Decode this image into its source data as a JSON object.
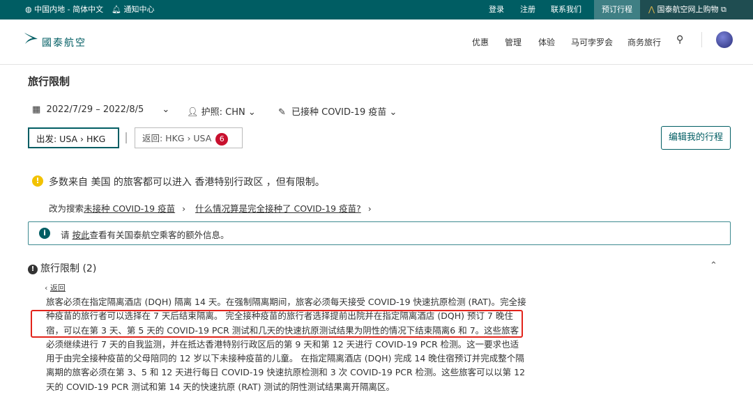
{
  "topbar": {
    "region": "中国内地 - 简体中文",
    "notifications": "通知中心",
    "login": "登录",
    "register": "注册",
    "contact": "联系我们",
    "book_trip": "预订行程",
    "shop": "国泰航空网上购物"
  },
  "nav": {
    "logo_text": "國泰航空",
    "items": [
      "优惠",
      "管理",
      "体验",
      "马可孛罗会",
      "商务旅行"
    ]
  },
  "page": {
    "title": "旅行限制",
    "filters": {
      "dates": "2022/7/29  –  2022/8/5",
      "passport": "护照: CHN",
      "vaccination": "已接种 COVID-19 疫苗"
    },
    "chips": {
      "outbound": "出发: USA  ›  HKG",
      "return": "返回: HKG  ›  USA",
      "return_count": "6"
    },
    "edit_button": "编辑我的行程",
    "summary": "多数来自 美国 的旅客都可以进入 香港特别行政区 ，但有限制。",
    "links": {
      "prefix": "改为搜索",
      "unvaccinated": "未接种 COVID-19 疫苗",
      "fully_vaccinated": "什么情况算是完全接种了 COVID-19 疫苗?"
    },
    "info": {
      "prefix": "请 ",
      "link": "按此",
      "suffix": "查看有关国泰航空乘客的额外信息。"
    },
    "section": {
      "title": "旅行限制 (2)",
      "back": "返回",
      "paragraph": "旅客必须在指定隔离酒店 (DQH) 隔离 14 天。在强制隔离期间，旅客必须每天接受 COVID-19 快速抗原检测 (RAT)。完全接种疫苗的旅行者可以选择在 7 天后结束隔离。 完全接种疫苗的旅行者选择提前出院并在指定隔离酒店 (DQH) 预订 7 晚住宿，可以在第 3 天、第 5 天的 COVID-19 PCR 测试和几天的快速抗原测试结果为阴性的情况下结束隔离6 和 7。这些旅客必须继续进行 7 天的自我监测，并在抵达香港特别行政区后的第 9 天和第 12 天进行 COVID-19 PCR 检测。这一要求也适用于由完全接种疫苗的父母陪同的 12 岁以下未接种疫苗的儿童。 在指定隔离酒店 (DQH) 完成 14 晚住宿预订并完成整个隔离期的旅客必须在第 3、5 和 12 天进行每日 COVID-19 快速抗原检测和 3 次 COVID-19 PCR 检测。这些旅客可以以第 12 天的 COVID-19 PCR 测试和第 14 天的快速抗原 (RAT) 测试的阴性测试结果离开隔离区。"
    }
  },
  "colors": {
    "brand": "#005d63",
    "alert": "#c8102e",
    "highlight": "#e2231a",
    "warning": "#f2c200"
  }
}
